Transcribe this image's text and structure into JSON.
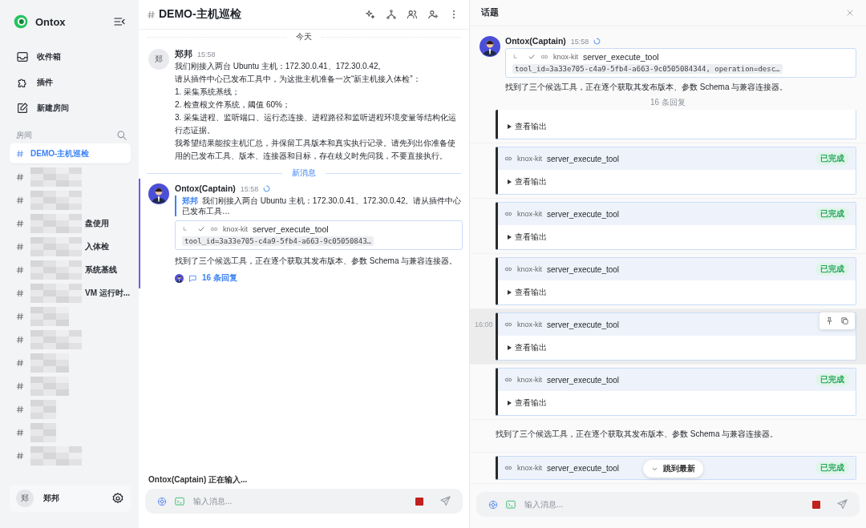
{
  "sidebar": {
    "brand": "Ontox",
    "nav": [
      {
        "label": "收件箱"
      },
      {
        "label": "插件"
      },
      {
        "label": "新建房间"
      }
    ],
    "rooms_label": "房间",
    "rooms": [
      {
        "name": "DEMO-主机巡检",
        "selected": true,
        "redacted": false
      },
      {
        "selected": false,
        "redacted": true
      },
      {
        "selected": false,
        "redacted": true
      },
      {
        "name": "盘使用",
        "selected": false,
        "redacted": true
      },
      {
        "name": "入体检",
        "selected": false,
        "redacted": true
      },
      {
        "name": "系统基线",
        "selected": false,
        "redacted": true
      },
      {
        "name": "VM 运行时...",
        "selected": false,
        "redacted": true
      },
      {
        "selected": false,
        "redacted": true
      },
      {
        "selected": false,
        "redacted": true
      },
      {
        "selected": false,
        "redacted": true
      },
      {
        "selected": false,
        "redacted": true
      },
      {
        "selected": false,
        "redacted": true
      },
      {
        "selected": false,
        "redacted": true
      },
      {
        "selected": false,
        "redacted": true
      }
    ],
    "user": {
      "avatar_text": "郑",
      "name": "郑邦"
    }
  },
  "chat": {
    "title": "DEMO-主机巡检",
    "date_divider": "今天",
    "messages": [
      {
        "kind": "user",
        "avatar_text": "郑",
        "author": "郑邦",
        "time": "15:58",
        "highlighted": false,
        "paragraphs": [
          "我们刚接入两台 Ubuntu 主机：172.30.0.41、172.30.0.42。",
          "请从插件中心已发布工具中，为这批主机准备一次“新主机接入体检”：",
          "1. 采集系统基线；",
          "2. 检查根文件系统，阈值 60%；",
          "3. 采集进程、监听端口、运行态连接、进程路径和监听进程环境变量等结构化运行态证据。",
          "我希望结果能按主机汇总，并保留工具版本和真实执行记录。请先列出你准备使用的已发布工具、版本、连接器和目标，存在歧义时先问我，不要直接执行。"
        ]
      },
      {
        "kind": "divider",
        "text": "新消息"
      },
      {
        "kind": "agent",
        "author": "Ontox(Captain)",
        "time": "15:58",
        "streaming": true,
        "highlighted": true,
        "quote": {
          "author": "郑邦",
          "text": "我们刚接入两台 Ubuntu 主机：172.30.0.41、172.30.0.42。请从插件中心已发布工具…"
        },
        "tool_call": {
          "done": true,
          "plugin": "knox-kit",
          "name": "server_execute_tool",
          "args": "tool_id=3a33e705-c4a9-5fb4-a663-9c05050843…"
        },
        "text": "找到了三个候选工具，正在逐个获取其发布版本、参数 Schema 与兼容连接器。",
        "replies": "16 条回复"
      }
    ],
    "typing": "Ontox(Captain) 正在输入...",
    "composer": {
      "placeholder": "输入消息..."
    }
  },
  "thread": {
    "title": "话题",
    "root": {
      "author": "Ontox(Captain)",
      "time": "15:58",
      "streaming": true,
      "tool_call": {
        "done": true,
        "plugin": "knox-kit",
        "name": "server_execute_tool",
        "args": "tool_id=3a33e705-c4a9-5fb4-a663-9c0505084344, operation=desc…"
      },
      "text": "找到了三个候选工具，正在逐个获取其发布版本、参数 Schema 与兼容连接器。",
      "reply_count": "16 条回复"
    },
    "items": [
      {
        "kind": "tool-tail",
        "output_label": "查看输出"
      },
      {
        "kind": "tool",
        "plugin": "knox-kit",
        "name": "server_execute_tool",
        "status": "已完成",
        "output_label": "查看输出",
        "hovered": false
      },
      {
        "kind": "tool",
        "plugin": "knox-kit",
        "name": "server_execute_tool",
        "status": "已完成",
        "output_label": "查看输出",
        "hovered": false
      },
      {
        "kind": "tool",
        "plugin": "knox-kit",
        "name": "server_execute_tool",
        "status": "已完成",
        "output_label": "查看输出",
        "hovered": false
      },
      {
        "kind": "tool",
        "plugin": "knox-kit",
        "name": "server_execute_tool",
        "time": "16:00",
        "output_label": "查看输出",
        "hovered": true
      },
      {
        "kind": "tool",
        "plugin": "knox-kit",
        "name": "server_execute_tool",
        "status": "已完成",
        "output_label": "查看输出",
        "hovered": false
      },
      {
        "kind": "text",
        "text": "找到了三个候选工具，正在逐个获取其发布版本、参数 Schema 与兼容连接器。"
      },
      {
        "kind": "tool",
        "plugin": "knox-kit",
        "name": "server_execute_tool",
        "status": "已完成",
        "hovered": false
      }
    ],
    "jump": "跳到最新",
    "composer": {
      "placeholder": "输入消息..."
    }
  }
}
